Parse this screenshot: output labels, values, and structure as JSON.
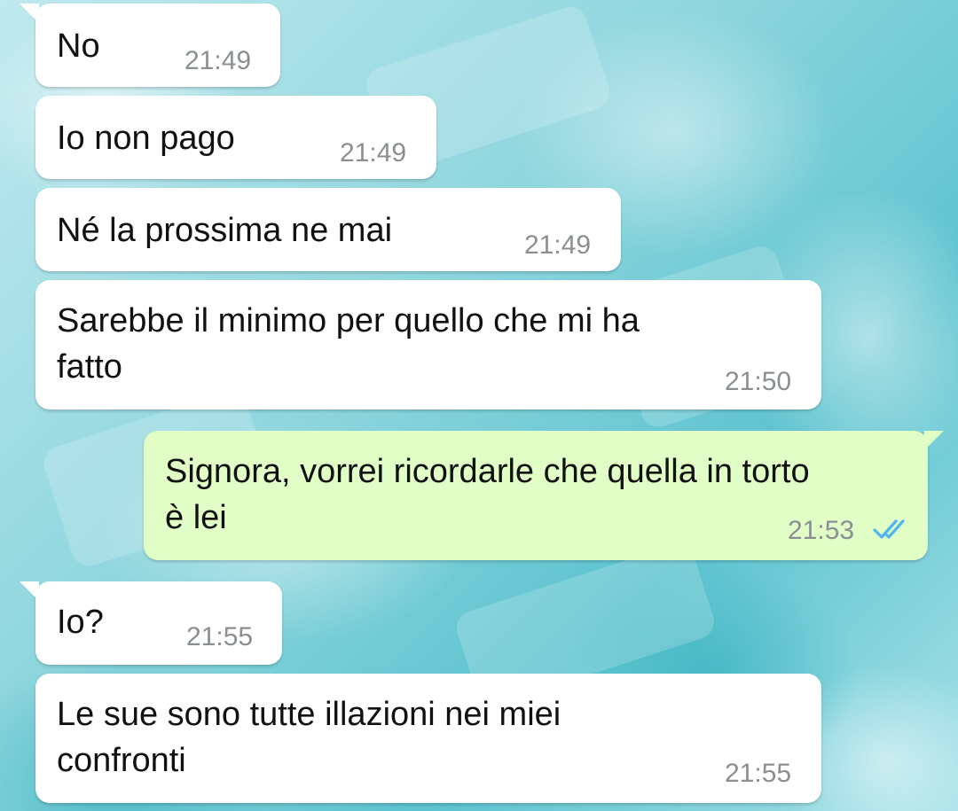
{
  "chat": {
    "messages": [
      {
        "direction": "in",
        "text": "No",
        "time": "21:49"
      },
      {
        "direction": "in",
        "text": "Io non pago",
        "time": "21:49"
      },
      {
        "direction": "in",
        "text": "Né la prossima ne mai",
        "time": "21:49"
      },
      {
        "direction": "in",
        "text": "Sarebbe il minimo per quello che mi ha\nfatto",
        "time": "21:50"
      },
      {
        "direction": "out",
        "text": "Signora, vorrei ricordarle che quella in torto\nè lei",
        "time": "21:53",
        "status_icon": "double-check-read-icon"
      },
      {
        "direction": "in",
        "text": "Io?",
        "time": "21:55"
      },
      {
        "direction": "in",
        "text": "Le sue sono tutte illazioni nei miei\nconfronti",
        "time": "21:55"
      }
    ]
  },
  "colors": {
    "incoming_bubble": "#ffffff",
    "outgoing_bubble": "#e1fec6",
    "read_ticks": "#4fb6ec",
    "timestamp": "#8a8f93"
  }
}
